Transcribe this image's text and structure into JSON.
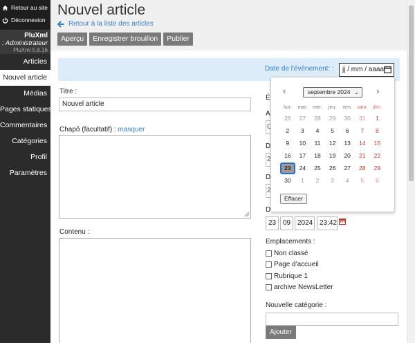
{
  "sidebar": {
    "back_to_site": "Retour au site",
    "logout": "Déconnexion",
    "brand_name": "PluXml",
    "user_role": ": Administrateur",
    "version": "PluXml 5.8.16",
    "nav": [
      "Articles",
      "Nouvel article",
      "Médias",
      "Pages statiques",
      "Commentaires",
      "Catégories",
      "Profil",
      "Paramètres"
    ]
  },
  "header": {
    "title": "Nouvel article",
    "back_link": "Retour à la liste des articles",
    "buttons": [
      "Aperçu",
      "Enregistrer brouillon",
      "Publier"
    ]
  },
  "event": {
    "label": "Date de l'évènement:  :",
    "placeholder": "jj / mm / aaaa"
  },
  "form": {
    "title_label": "Titre :",
    "title_value": "Nouvel article",
    "chapo_label": "Chapô (facultatif) :",
    "chapo_toggle": "masquer",
    "content_label": "Contenu :"
  },
  "right": {
    "hidden_labels": [
      "Ét",
      "A",
      "D",
      "D",
      "D"
    ],
    "hidden_values": [
      "G",
      "2",
      "2"
    ],
    "date_day": "23",
    "date_month": "09",
    "date_year": "2024",
    "date_time": "23:42",
    "locations_label": "Emplacements :",
    "locations": [
      "Non classé",
      "Page d'accueil",
      "Rubrique 1",
      "archive NewsLetter"
    ],
    "new_category_label": "Nouvelle catégorie :",
    "add_button": "Ajouter"
  },
  "calendar": {
    "month_label": "septembre 2024",
    "weekdays": [
      "lun.",
      "mar.",
      "mer.",
      "jeu.",
      "ven.",
      "sam.",
      "dim."
    ],
    "weeks": [
      [
        "26",
        "27",
        "28",
        "29",
        "30",
        "31",
        "1"
      ],
      [
        "2",
        "3",
        "4",
        "5",
        "6",
        "7",
        "8"
      ],
      [
        "9",
        "10",
        "11",
        "12",
        "13",
        "14",
        "15"
      ],
      [
        "16",
        "17",
        "18",
        "19",
        "20",
        "21",
        "22"
      ],
      [
        "23",
        "24",
        "25",
        "26",
        "27",
        "28",
        "29"
      ],
      [
        "30",
        "1",
        "2",
        "3",
        "4",
        "5",
        "6"
      ]
    ],
    "selected": "23",
    "clear_button": "Effacer"
  },
  "colors": {
    "sidebar_bg": "#2b2b2b",
    "link_blue": "#3a7fc4",
    "event_bar_bg": "#dcecf8",
    "button_gray": "#7a7a7a",
    "weekend_red": "#c0392b"
  }
}
